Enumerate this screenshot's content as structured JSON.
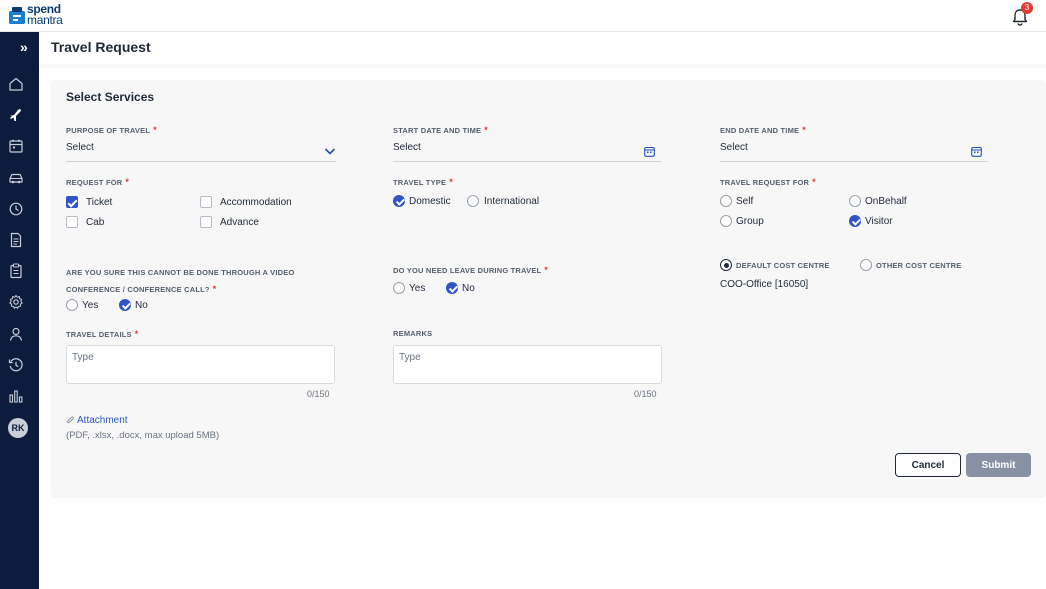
{
  "app": {
    "logo_line1": "spend",
    "logo_line2": "mantra",
    "notification_count": "3",
    "brand_color": "#0d1b3d",
    "accent_color": "#2f56c4"
  },
  "sidebar": {
    "toggle_icon": "double-chevron-right-icon",
    "items": [
      {
        "icon": "home-icon"
      },
      {
        "icon": "plane-icon"
      },
      {
        "icon": "calendar-icon"
      },
      {
        "icon": "car-icon"
      },
      {
        "icon": "history-icon"
      },
      {
        "icon": "document-icon"
      },
      {
        "icon": "clipboard-icon"
      },
      {
        "icon": "settings-icon"
      },
      {
        "icon": "user-icon"
      },
      {
        "icon": "clock-icon"
      },
      {
        "icon": "bar-chart-icon"
      }
    ],
    "avatar_initials": "RK"
  },
  "page": {
    "title": "Travel Request",
    "section_title": "Select Services"
  },
  "form": {
    "purpose": {
      "label": "PURPOSE OF TRAVEL",
      "value": "Select"
    },
    "start": {
      "label": "START DATE AND TIME",
      "value": "Select"
    },
    "end": {
      "label": "END DATE AND TIME",
      "value": "Select"
    },
    "request_for": {
      "label": "REQUEST FOR",
      "options": [
        {
          "label": "Ticket",
          "checked": true
        },
        {
          "label": "Accommodation",
          "checked": false
        },
        {
          "label": "Cab",
          "checked": false
        },
        {
          "label": "Advance",
          "checked": false
        }
      ]
    },
    "travel_type": {
      "label": "TRAVEL TYPE",
      "options": [
        {
          "label": "Domestic",
          "checked": true
        },
        {
          "label": "International",
          "checked": false
        }
      ]
    },
    "travel_request_for": {
      "label": "TRAVEL REQUEST FOR",
      "options": [
        {
          "label": "Self",
          "checked": false
        },
        {
          "label": "OnBehalf",
          "checked": false
        },
        {
          "label": "Group",
          "checked": false
        },
        {
          "label": "Visitor",
          "checked": true
        }
      ]
    },
    "video_conf": {
      "label_line1": "ARE YOU SURE THIS CANNOT BE DONE THROUGH A VIDEO",
      "label_line2": "CONFERENCE / CONFERENCE CALL?",
      "options": [
        {
          "label": "Yes",
          "checked": false
        },
        {
          "label": "No",
          "checked": true
        }
      ]
    },
    "leave": {
      "label": "DO YOU NEED LEAVE DURING TRAVEL",
      "options": [
        {
          "label": "Yes",
          "checked": false
        },
        {
          "label": "No",
          "checked": true
        }
      ]
    },
    "cost_centre": {
      "options": [
        {
          "label": "DEFAULT COST CENTRE",
          "checked": true
        },
        {
          "label": "OTHER COST CENTRE",
          "checked": false
        }
      ],
      "value": "COO-Office [16050]"
    },
    "travel_details": {
      "label": "TRAVEL DETAILS",
      "placeholder": "Type",
      "counter": "0/150"
    },
    "remarks": {
      "label": "REMARKS",
      "placeholder": "Type",
      "counter": "0/150"
    },
    "attachment": {
      "label": "Attachment",
      "hint": "(PDF, .xlsx, .docx, max upload 5MB)"
    },
    "required_mark": "*"
  },
  "actions": {
    "cancel_label": "Cancel",
    "submit_label": "Submit"
  }
}
